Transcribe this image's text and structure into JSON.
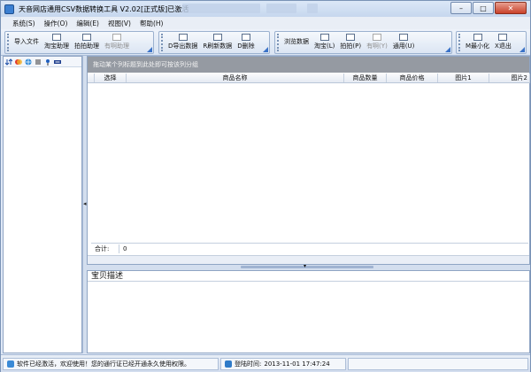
{
  "window": {
    "title": "天音网店通用CSV数据转换工具 V2.02[正式版]已激活",
    "minimize": "–",
    "maximize": "□",
    "close": "✕"
  },
  "menu": [
    {
      "label": "系统(S)"
    },
    {
      "label": "操作(O)"
    },
    {
      "label": "编辑(E)"
    },
    {
      "label": "视图(V)"
    },
    {
      "label": "帮助(H)"
    }
  ],
  "toolbar": {
    "group1": [
      {
        "label": "导入文件",
        "icon": "import-icon",
        "enabled": true
      },
      {
        "label": "淘宝助理",
        "icon": "taobao-assistant-icon",
        "enabled": true
      },
      {
        "label": "拍拍助理",
        "icon": "paipai-assistant-icon",
        "enabled": true
      },
      {
        "label": "有啊助理",
        "icon": "youa-assistant-icon",
        "enabled": false
      }
    ],
    "group2": [
      {
        "label": "D导出数据",
        "icon": "export-icon",
        "enabled": true
      },
      {
        "label": "R刷新数据",
        "icon": "refresh-icon",
        "enabled": true
      },
      {
        "label": "D删除",
        "icon": "delete-icon",
        "enabled": true
      }
    ],
    "group3": [
      {
        "label": "浏览数据",
        "icon": "browse-icon",
        "enabled": true
      },
      {
        "label": "淘宝(L)",
        "icon": "taobao-icon",
        "enabled": true
      },
      {
        "label": "拍拍(P)",
        "icon": "paipai-icon",
        "enabled": true
      },
      {
        "label": "有啊(Y)",
        "icon": "youa-icon",
        "enabled": false
      },
      {
        "label": "通用(U)",
        "icon": "general-icon",
        "enabled": true
      }
    ],
    "group4": [
      {
        "label": "M最小化",
        "icon": "minimize-icon",
        "enabled": true
      },
      {
        "label": "X退出",
        "icon": "exit-icon",
        "enabled": true
      }
    ]
  },
  "grid": {
    "group_hint": "拖动某个列标题到此处即可按该列分组",
    "columns": [
      "选择",
      "商品名称",
      "商品数量",
      "商品价格",
      "图片1",
      "图片2"
    ],
    "total_label": "合计:",
    "total_value": "0"
  },
  "description": {
    "title": "宝贝描述"
  },
  "status": {
    "message": "软件已经激活，欢迎使用！您的通行证已经开通永久使用权限。",
    "login_label": "登陆时间:",
    "login_time": "2013-11-01 17:47:24"
  },
  "colors": {
    "accent": "#3b73c8",
    "group_hint_bg": "#959aa2",
    "chrome_bg": "#dfe8f6"
  }
}
